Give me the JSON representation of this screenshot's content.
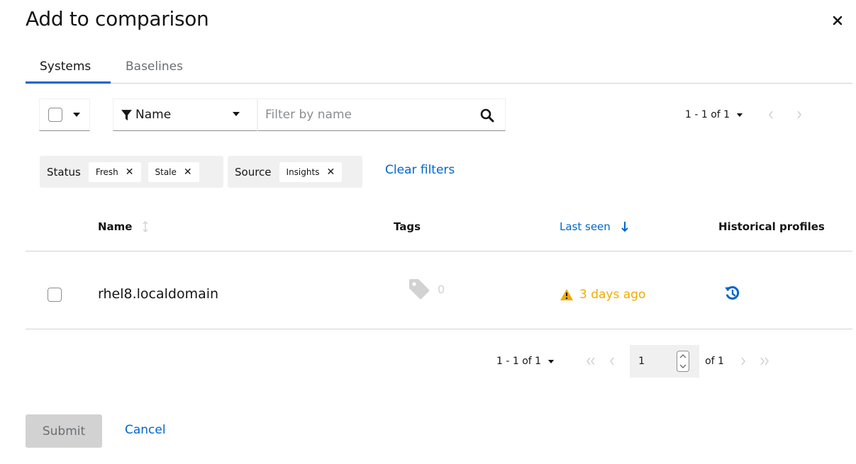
{
  "modal": {
    "title": "Add to comparison"
  },
  "tabs": [
    {
      "label": "Systems",
      "active": true
    },
    {
      "label": "Baselines",
      "active": false
    }
  ],
  "toolbar": {
    "filter_attribute": "Name",
    "search_placeholder": "Filter by name",
    "pagination_toggle": "1 - 1 of 1"
  },
  "chip_groups": [
    {
      "label": "Status",
      "chips": [
        "Fresh",
        "Stale"
      ]
    },
    {
      "label": "Source",
      "chips": [
        "Insights"
      ]
    }
  ],
  "clear_filters_label": "Clear filters",
  "table": {
    "columns": [
      "Name",
      "Tags",
      "Last seen",
      "Historical profiles"
    ],
    "rows": [
      {
        "name": "rhel8.localdomain",
        "tags_count": "0",
        "last_seen": "3 days ago"
      }
    ]
  },
  "bottom_pagination": {
    "toggle": "1 - 1 of 1",
    "page": "1",
    "of_total": "of 1"
  },
  "actions": {
    "submit_label": "Submit",
    "cancel_label": "Cancel"
  },
  "colors": {
    "primary": "#0066cc",
    "warning": "#f0ab00",
    "border": "#d2d2d2",
    "chip_bg": "#f0f0f0"
  }
}
